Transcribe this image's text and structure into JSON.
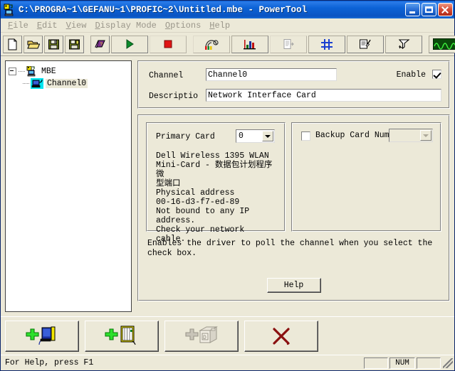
{
  "window": {
    "title": "C:\\PROGRA~1\\GEFANU~1\\PROFIC~2\\Untitled.mbe - PowerTool",
    "icon": "mbe-document-icon",
    "minimize_label": "Minimize",
    "maximize_label": "Maximize",
    "close_label": "Close"
  },
  "menu": {
    "items": [
      {
        "label": "File",
        "accel": "F"
      },
      {
        "label": "Edit",
        "accel": "E"
      },
      {
        "label": "View",
        "accel": "V"
      },
      {
        "label": "Display Mode",
        "accel": "D"
      },
      {
        "label": "Options",
        "accel": "O"
      },
      {
        "label": "Help",
        "accel": "H"
      }
    ]
  },
  "toolbar": {
    "groups": [
      {
        "buttons": [
          {
            "name": "new-file-button",
            "icon": "new-document-icon"
          },
          {
            "name": "open-file-button",
            "icon": "open-folder-icon"
          },
          {
            "name": "save-button",
            "icon": "floppy-disk-icon"
          },
          {
            "name": "save-all-button",
            "icon": "floppy-disk-all-icon"
          },
          {
            "name": "about-button",
            "icon": "purple-book-icon"
          }
        ]
      },
      {
        "buttons": [
          {
            "name": "start-button",
            "icon": "play-triangle-icon"
          },
          {
            "name": "stop-button",
            "icon": "stop-square-icon"
          },
          {
            "name": "configure-button",
            "icon": "wiring-tools-icon"
          },
          {
            "name": "statistics-button",
            "icon": "bar-chart-icon"
          }
        ]
      },
      {
        "buttons": [
          {
            "name": "report-button",
            "icon": "document-export-icon"
          },
          {
            "name": "network-button",
            "icon": "blue-grid-icon"
          },
          {
            "name": "import-button",
            "icon": "document-paint-icon"
          },
          {
            "name": "tool-button",
            "icon": "funnel-hand-icon"
          },
          {
            "name": "monitor-button",
            "icon": "green-waveform-icon"
          }
        ]
      }
    ]
  },
  "tree": {
    "root": {
      "label": "MBE",
      "icon": "mbe-server-icon",
      "expanded": true
    },
    "children": [
      {
        "label": "Channel0",
        "icon": "channel-card-icon",
        "selected": true
      }
    ]
  },
  "channel_panel": {
    "channel_label": "Channel",
    "channel_value": "Channel0",
    "description_label": "Descriptio",
    "description_value": "Network Interface Card",
    "enable_label": "Enable",
    "enable_checked": true
  },
  "primary_card": {
    "label": "Primary Card",
    "selected": "0",
    "info_lines": [
      "Dell Wireless 1395 WLAN",
      "Mini-Card - 数据包计划程序微",
      "型端口",
      "Physical address",
      "00-16-d3-f7-ed-89",
      "Not bound to any IP address.",
      "Check your network cable."
    ]
  },
  "backup_card": {
    "label": "Backup Card Number",
    "checked": false,
    "selected": "",
    "disabled": true
  },
  "hint": {
    "text": "Enables the driver to poll the channel when you select the check box."
  },
  "help_button": {
    "label": "Help"
  },
  "bottom_bar": {
    "buttons": [
      {
        "name": "add-channel-button",
        "icon": "add-device-icon"
      },
      {
        "name": "add-board-button",
        "icon": "add-rack-icon"
      },
      {
        "name": "add-datablock-button",
        "icon": "add-cube-icon",
        "disabled": true
      },
      {
        "name": "delete-button",
        "icon": "red-x-icon"
      }
    ]
  },
  "statusbar": {
    "message": "For Help, press F1",
    "panes": [
      "",
      "NUM",
      ""
    ]
  }
}
